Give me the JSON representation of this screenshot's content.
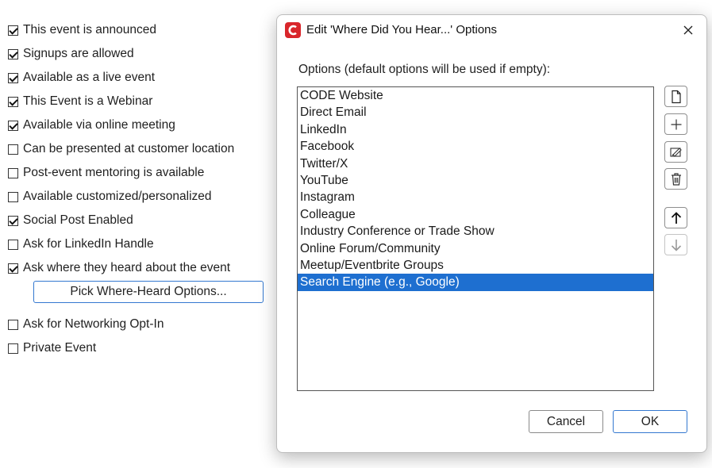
{
  "checkboxes": [
    {
      "label": "This event is announced",
      "checked": true
    },
    {
      "label": "Signups are allowed",
      "checked": true
    },
    {
      "label": "Available as a live event",
      "checked": true
    },
    {
      "label": "This Event is a Webinar",
      "checked": true
    },
    {
      "label": "Available via online meeting",
      "checked": true
    },
    {
      "label": "Can be presented at customer location",
      "checked": false
    },
    {
      "label": "Post-event mentoring is available",
      "checked": false
    },
    {
      "label": "Available customized/personalized",
      "checked": false
    },
    {
      "label": "Social Post Enabled",
      "checked": true
    },
    {
      "label": "Ask for LinkedIn Handle",
      "checked": false
    },
    {
      "label": "Ask where they heard about the event",
      "checked": true
    },
    {
      "label": "Ask for Networking Opt-In",
      "checked": false
    },
    {
      "label": "Private Event",
      "checked": false
    }
  ],
  "pick_button_label": "Pick Where-Heard Options...",
  "dialog": {
    "title": "Edit 'Where Did You Hear...' Options",
    "prompt": "Options (default options will be used if empty):",
    "options": [
      "CODE Website",
      "Direct Email",
      "LinkedIn",
      "Facebook",
      "Twitter/X",
      "YouTube",
      "Instagram",
      "Colleague",
      "Industry Conference or Trade Show",
      "Online Forum/Community",
      "Meetup/Eventbrite Groups",
      "Search Engine (e.g., Google)"
    ],
    "selected_option": "Search Engine (e.g., Google)",
    "toolbar_icons": [
      "new-document-icon",
      "plus-icon",
      "edit-icon",
      "trash-icon",
      "arrow-up-icon",
      "arrow-down-icon"
    ],
    "cancel_label": "Cancel",
    "ok_label": "OK"
  },
  "colors": {
    "selection": "#1e6fd0",
    "accent_border": "#3478d0",
    "app_logo": "#d9262b"
  }
}
